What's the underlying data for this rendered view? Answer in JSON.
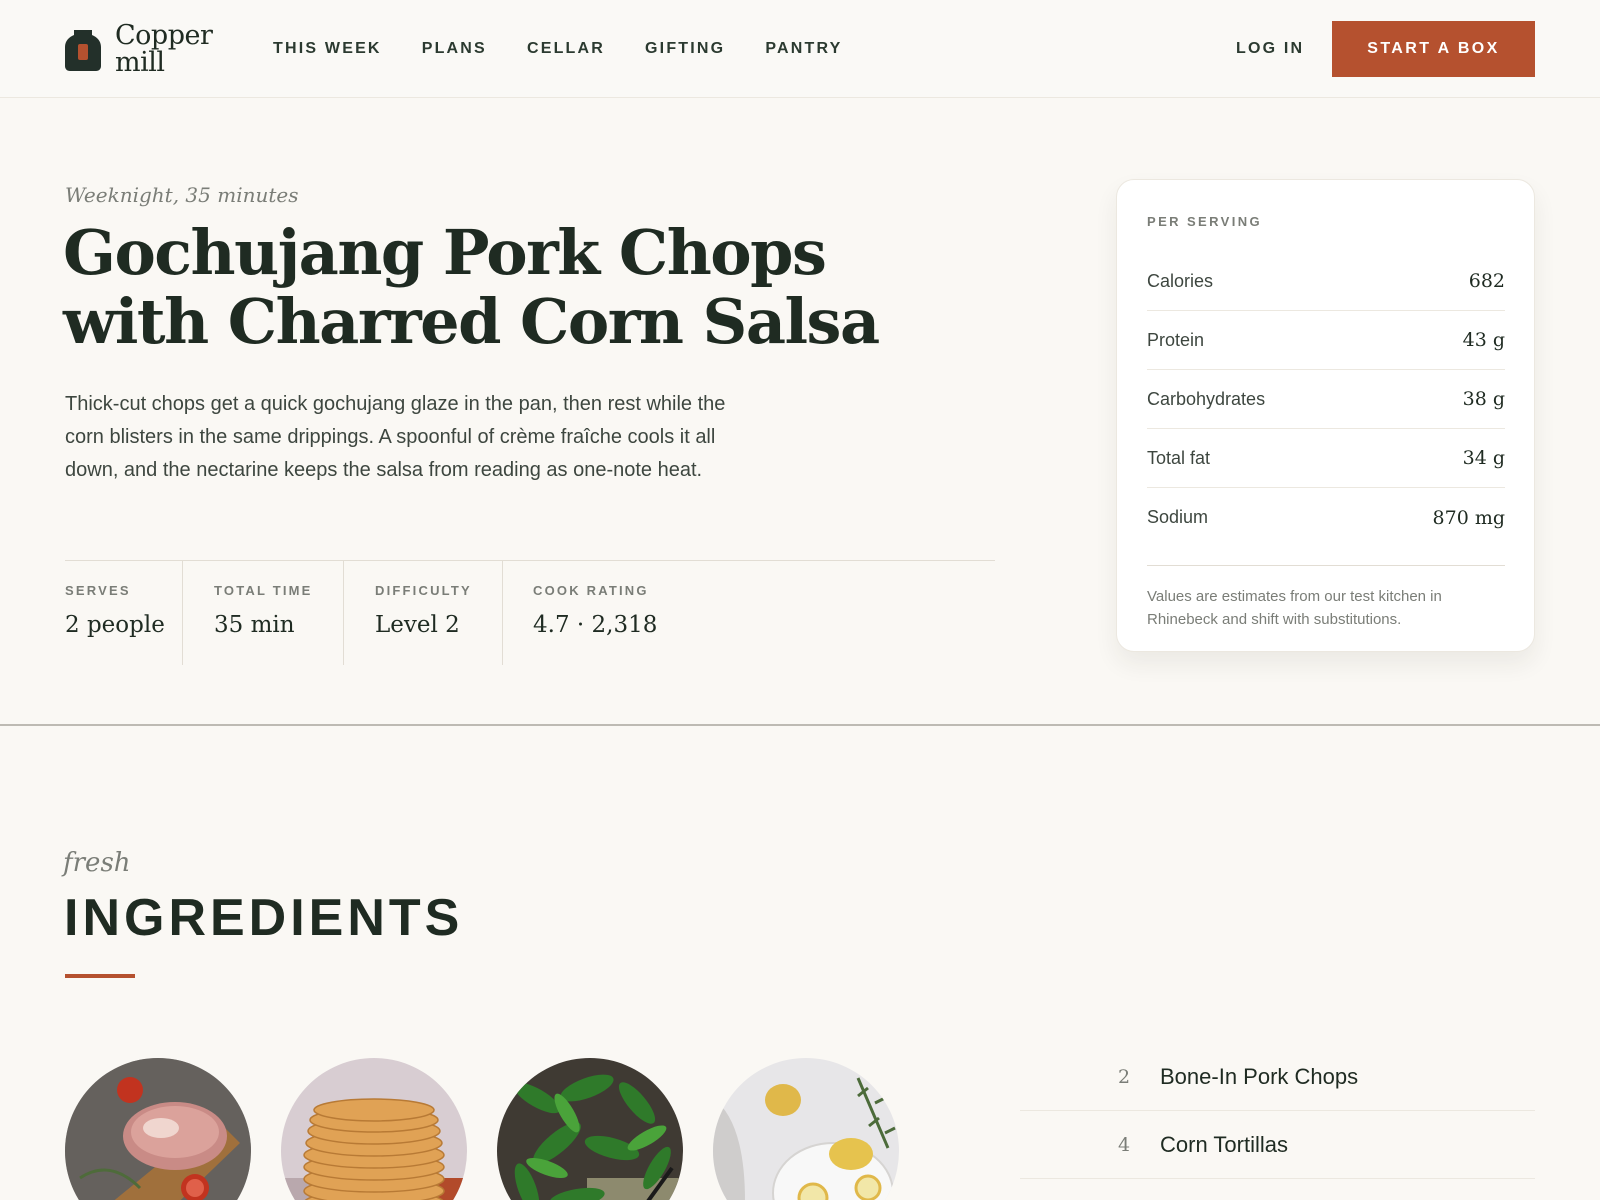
{
  "brand": {
    "name_line1": "Copper",
    "name_line2": "mill",
    "icon": "bag-logo-icon"
  },
  "nav": {
    "items": [
      "THIS WEEK",
      "PLANS",
      "CELLAR",
      "GIFTING",
      "PANTRY"
    ],
    "login": "LOG IN",
    "cta": "START A BOX"
  },
  "recipe": {
    "kicker": "Weeknight, 35 minutes",
    "title_line1": "Gochujang Pork Chops",
    "title_line2": "with Charred Corn Salsa",
    "description": "Thick-cut chops get a quick gochujang glaze in the pan, then rest while the corn blisters in the same drippings. A spoonful of crème fraîche cools it all down, and the nectarine keeps the salsa from reading as one-note heat."
  },
  "stats": [
    {
      "label": "SERVES",
      "value": "2 people"
    },
    {
      "label": "TOTAL TIME",
      "value": "35 min"
    },
    {
      "label": "DIFFICULTY",
      "value": "Level 2"
    },
    {
      "label": "COOK RATING",
      "value": "4.7 · 2,318"
    }
  ],
  "nutrition": {
    "label": "PER SERVING",
    "rows": [
      {
        "name": "Calories",
        "value": "682"
      },
      {
        "name": "Protein",
        "value": "43 g"
      },
      {
        "name": "Carbohydrates",
        "value": "38 g"
      },
      {
        "name": "Total fat",
        "value": "34 g"
      },
      {
        "name": "Sodium",
        "value": "870 mg"
      }
    ],
    "note": "Values are estimates from our test kitchen in Rhinebeck and shift with substitutions."
  },
  "ingredients": {
    "kicker": "fresh",
    "heading": "INGREDIENTS",
    "thumbnails": [
      "pork-chops-photo",
      "corn-tortillas-photo",
      "green-peppers-photo",
      "lemons-photo"
    ],
    "items": [
      {
        "qty": "2",
        "name": "Bone-In Pork Chops"
      },
      {
        "qty": "4",
        "name": "Corn Tortillas"
      }
    ]
  },
  "colors": {
    "accent": "#b5512f",
    "ink": "#1f2b22",
    "background": "#faf8f4"
  }
}
